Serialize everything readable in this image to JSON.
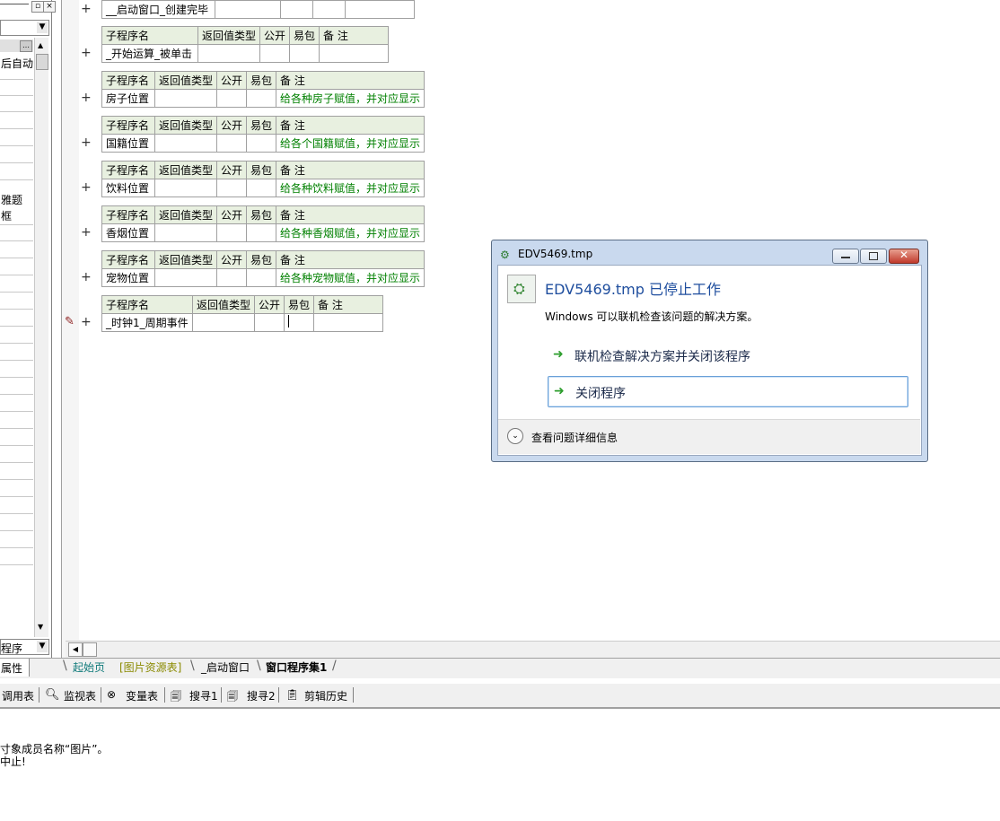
{
  "left_panel": {
    "top_label": "后自动",
    "item_a": "雅题",
    "item_b": "框",
    "dropdown_text": "程序",
    "tab_label": "属性"
  },
  "editor": {
    "first_row": "__启动窗口_创建完毕",
    "header": {
      "name": "子程序名",
      "ret": "返回值类型",
      "pub": "公开",
      "easy": "易包",
      "note": "备 注"
    },
    "subs": [
      {
        "name": "_开始运算_被单击",
        "note": ""
      },
      {
        "name": "房子位置",
        "note": "给各种房子赋值，并对应显示"
      },
      {
        "name": "国籍位置",
        "note": "给各个国籍赋值，并对应显示"
      },
      {
        "name": "饮料位置",
        "note": "给各种饮料赋值，并对应显示"
      },
      {
        "name": "香烟位置",
        "note": "给各种香烟赋值，并对应显示"
      },
      {
        "name": "宠物位置",
        "note": "给各种宠物赋值，并对应显示"
      },
      {
        "name": "_时钟1_周期事件",
        "note": ""
      }
    ],
    "plus": "+"
  },
  "dialog": {
    "title": "EDV5469.tmp",
    "heading": "EDV5469.tmp 已停止工作",
    "message": "Windows 可以联机检查该问题的解决方案。",
    "option1": "联机检查解决方案并关闭该程序",
    "option2": "关闭程序",
    "details": "查看问题详细信息"
  },
  "tabs": [
    "起始页",
    "[图片资源表]",
    "_启动窗口",
    "窗口程序集1"
  ],
  "toolbar": [
    "调用表",
    "监视表",
    "变量表",
    "搜寻1",
    "搜寻2",
    "剪辑历史"
  ],
  "output": {
    "line1": "寸象成员名称“图片”。",
    "line2": "中止!"
  },
  "colors": {
    "accent_blue": "#1f4e9e",
    "comment_green": "#008000",
    "arrow_green": "#2e9e2e"
  }
}
